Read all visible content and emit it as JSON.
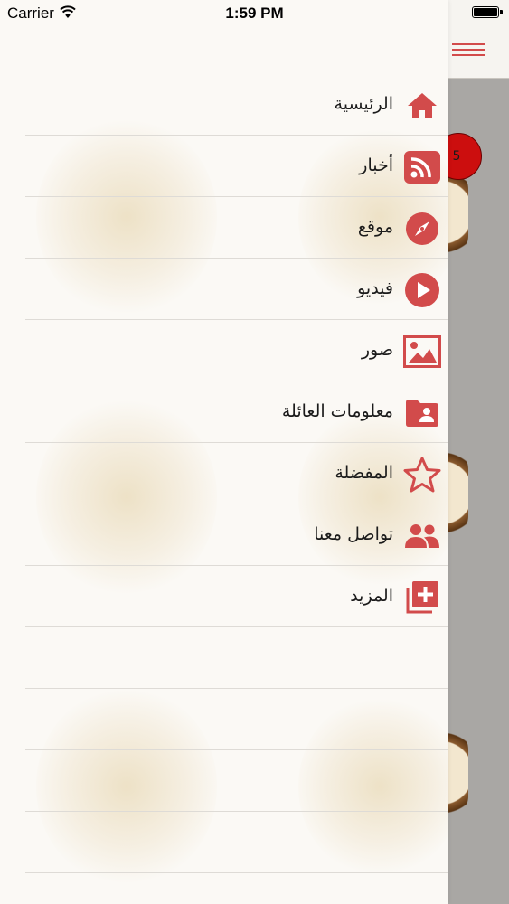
{
  "status_bar": {
    "carrier": "Carrier",
    "time": "1:59 PM"
  },
  "underlying_screen": {
    "notification_badge": "5"
  },
  "drawer": {
    "accent_color": "#d24b4b",
    "items": [
      {
        "label": "الرئيسية",
        "icon": "home-icon"
      },
      {
        "label": "أخبار",
        "icon": "rss-icon"
      },
      {
        "label": "موقع",
        "icon": "compass-icon"
      },
      {
        "label": "فيديو",
        "icon": "play-icon"
      },
      {
        "label": "صور",
        "icon": "image-icon"
      },
      {
        "label": "معلومات العائلة",
        "icon": "contact-folder-icon"
      },
      {
        "label": "المفضلة",
        "icon": "star-icon"
      },
      {
        "label": "تواصل معنا",
        "icon": "people-icon"
      },
      {
        "label": "المزيد",
        "icon": "add-more-icon"
      }
    ]
  }
}
